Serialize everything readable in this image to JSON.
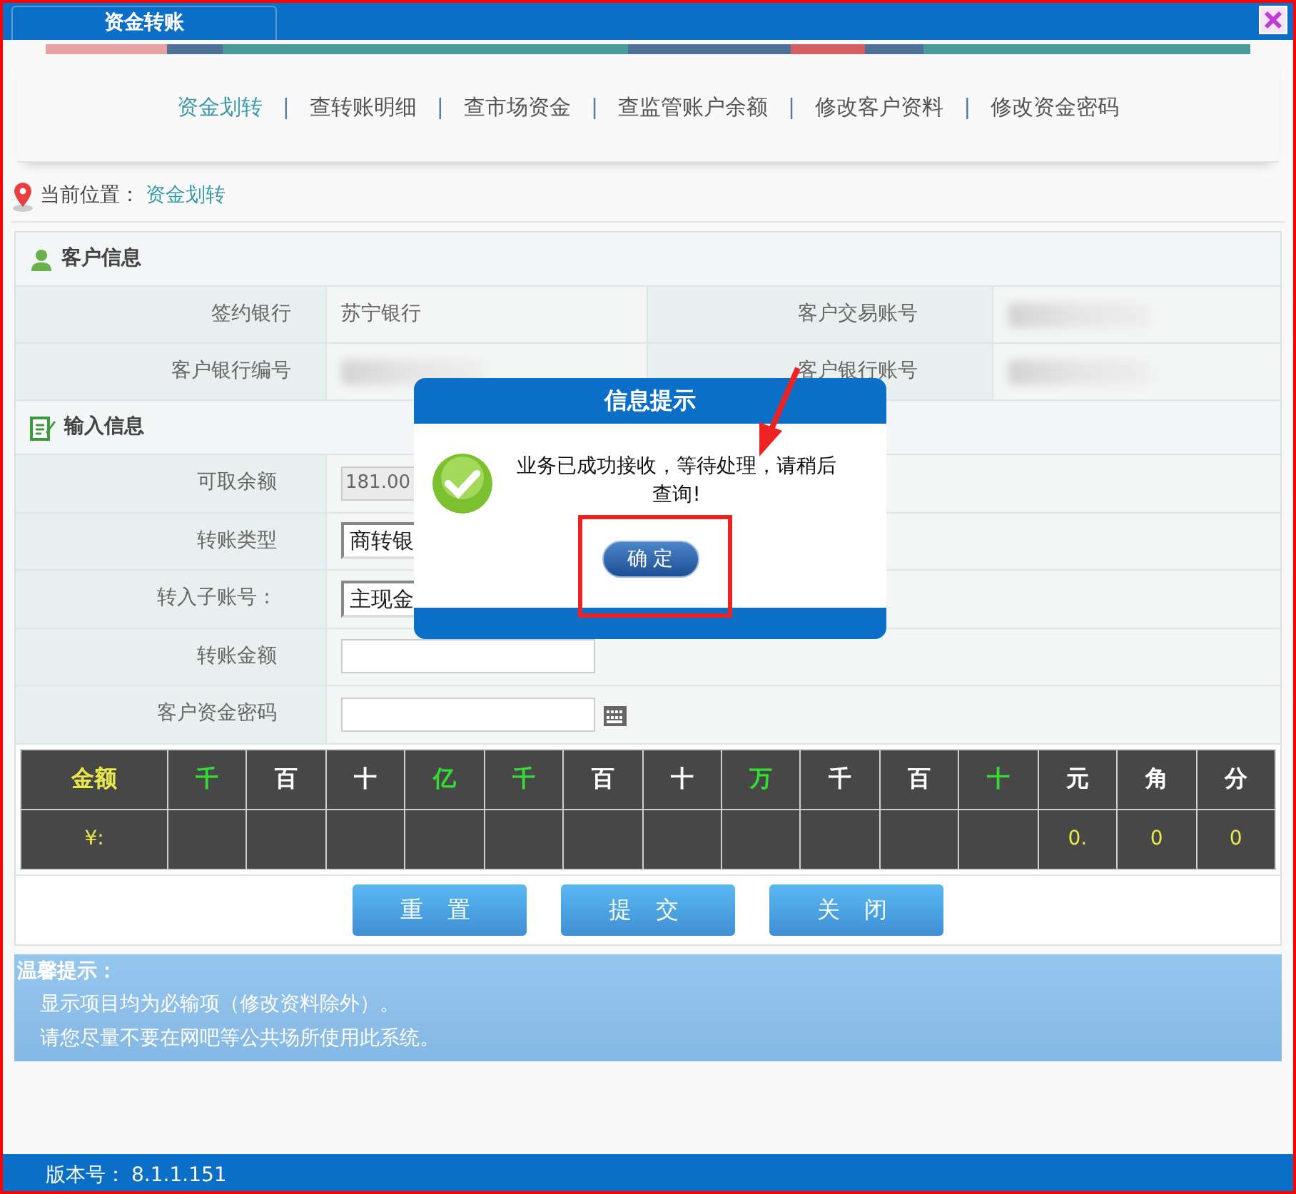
{
  "window": {
    "tab": "资金转账"
  },
  "nav": [
    {
      "label": "资金划转",
      "selected": true
    },
    {
      "separator": "|",
      "label": "查转账明细",
      "selected": false
    },
    {
      "separator": "|",
      "label": "查市场资金",
      "selected": false
    },
    {
      "separator": "|",
      "label": "查监管账户余额",
      "selected": false
    },
    {
      "separator": "|",
      "label": "修改客户资料",
      "selected": false
    },
    {
      "separator": "|",
      "label": "修改资金密码",
      "selected": false
    }
  ],
  "location": {
    "label": "当前位置：",
    "value": "资金划转"
  },
  "customer_info": {
    "title": "客户信息",
    "rows": [
      {
        "label": "签约银行",
        "value": "苏宁银行",
        "label_2": "客户交易账号",
        "value_2_redacted": true
      },
      {
        "label": "客户银行编号",
        "value_redacted": true,
        "label_2": "客户银行账号",
        "value_2_redacted": true
      }
    ]
  },
  "input_info": {
    "title": "输入信息",
    "fields": [
      {
        "kind": "readonly",
        "label": "可取余额",
        "value": "181.00"
      },
      {
        "kind": "select",
        "label": "转账类型",
        "value": "商转银"
      },
      {
        "kind": "select",
        "label": "转入子账号：",
        "value": "主现金"
      },
      {
        "kind": "text",
        "label": "转账金额"
      },
      {
        "kind": "password",
        "label": "客户资金密码"
      }
    ]
  },
  "amount_grid": {
    "header": [
      {
        "text": "金额",
        "color": "#e8e84a"
      },
      {
        "text": "千",
        "color": "#33dd33"
      },
      {
        "text": "百",
        "color": "#ffffff"
      },
      {
        "text": "十",
        "color": "#ffffff"
      },
      {
        "text": "亿",
        "color": "#33dd33"
      },
      {
        "text": "千",
        "color": "#33dd33"
      },
      {
        "text": "百",
        "color": "#ffffff"
      },
      {
        "text": "十",
        "color": "#ffffff"
      },
      {
        "text": "万",
        "color": "#33dd33"
      },
      {
        "text": "千",
        "color": "#ffffff"
      },
      {
        "text": "百",
        "color": "#ffffff"
      },
      {
        "text": "十",
        "color": "#33dd33"
      },
      {
        "text": "元",
        "color": "#ffffff"
      },
      {
        "text": "角",
        "color": "#ffffff"
      },
      {
        "text": "分",
        "color": "#ffffff"
      }
    ],
    "value_label": "¥:",
    "value_digits": [
      "0.",
      "0",
      "0"
    ]
  },
  "buttons": [
    "重 置",
    "提 交",
    "关 闭"
  ],
  "tips": {
    "title": "温馨提示：",
    "lines": [
      "显示项目均为必输项（修改资料除外）。",
      "请您尽量不要在网吧等公共场所使用此系统。"
    ]
  },
  "footer": {
    "label": "版本号：",
    "value": "8.1.1.151"
  },
  "dialog": {
    "title": "信息提示",
    "message": "业务已成功接收，等待处理，请稍后查询!",
    "button": "确 定"
  }
}
